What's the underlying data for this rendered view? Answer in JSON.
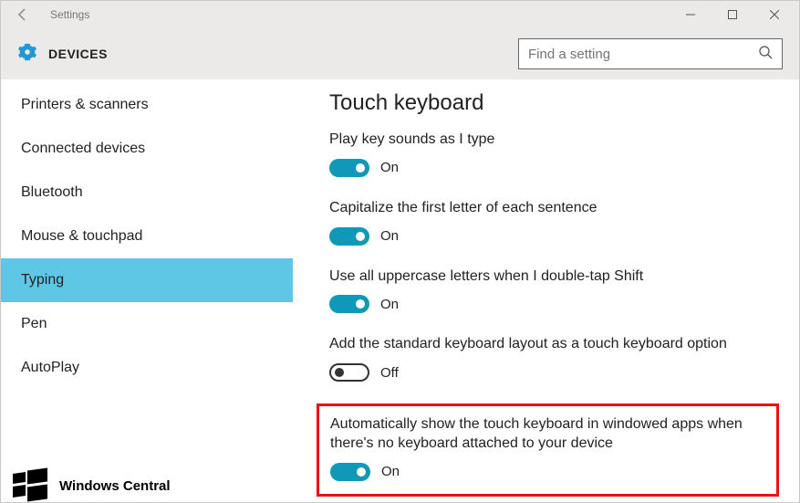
{
  "titlebar": {
    "title": "Settings"
  },
  "header": {
    "section": "DEVICES",
    "search_placeholder": "Find a setting"
  },
  "sidebar": {
    "items": [
      {
        "label": "Printers & scanners",
        "selected": false
      },
      {
        "label": "Connected devices",
        "selected": false
      },
      {
        "label": "Bluetooth",
        "selected": false
      },
      {
        "label": "Mouse & touchpad",
        "selected": false
      },
      {
        "label": "Typing",
        "selected": true
      },
      {
        "label": "Pen",
        "selected": false
      },
      {
        "label": "AutoPlay",
        "selected": false
      }
    ]
  },
  "main": {
    "title": "Touch keyboard",
    "settings": [
      {
        "label": "Play key sounds as I type",
        "value": true,
        "state": "On"
      },
      {
        "label": "Capitalize the first letter of each sentence",
        "value": true,
        "state": "On"
      },
      {
        "label": "Use all uppercase letters when I double-tap Shift",
        "value": true,
        "state": "On"
      },
      {
        "label": "Add the standard keyboard layout as a touch keyboard option",
        "value": false,
        "state": "Off"
      },
      {
        "label": "Automatically show the touch keyboard in windowed apps when there's no keyboard attached to your device",
        "value": true,
        "state": "On",
        "highlighted": true
      }
    ]
  },
  "watermark": {
    "text": "Windows Central"
  }
}
